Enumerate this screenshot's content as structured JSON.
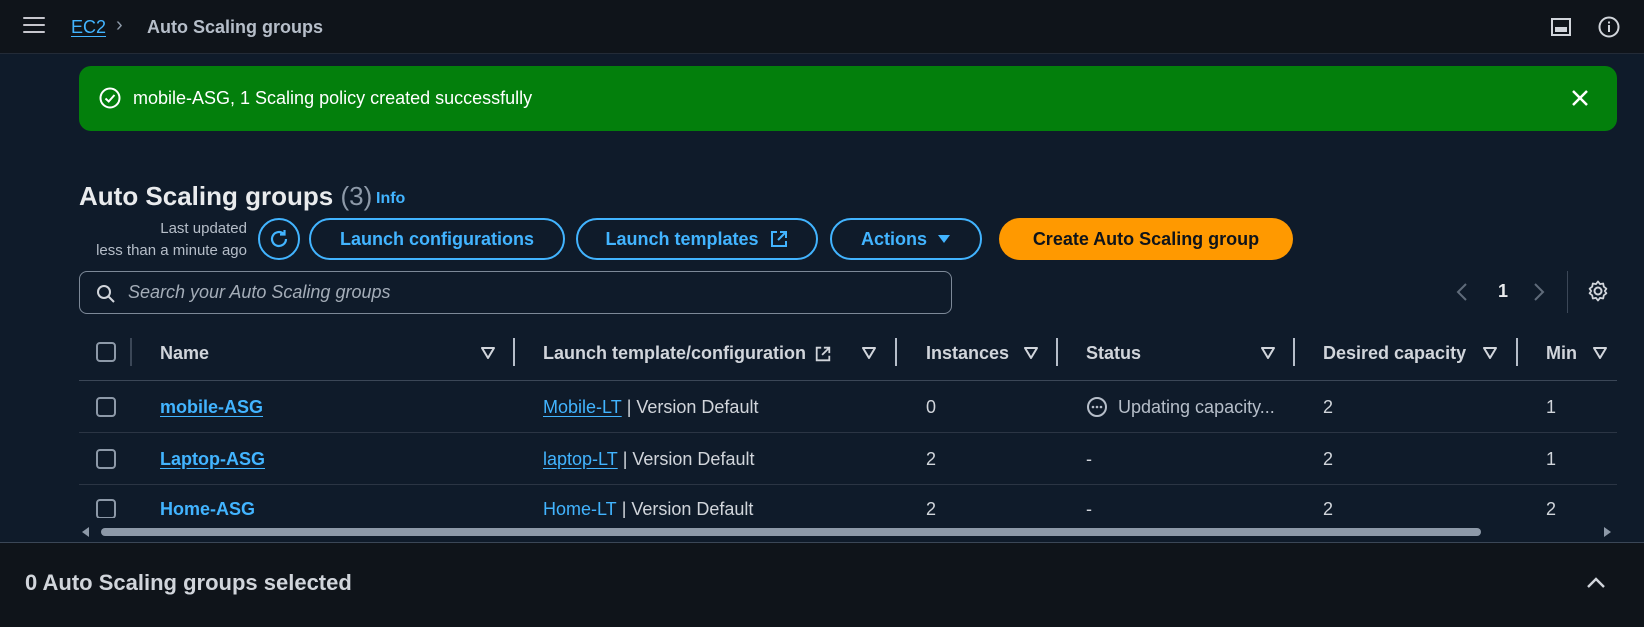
{
  "breadcrumb": {
    "parent": "EC2",
    "current": "Auto Scaling groups"
  },
  "flash": {
    "message": "mobile-ASG, 1 Scaling policy created successfully",
    "color": "#037f0c"
  },
  "header": {
    "title": "Auto Scaling groups",
    "count": "(3)",
    "info_label": "Info",
    "last_updated_line1": "Last updated",
    "last_updated_line2": "less than a minute ago"
  },
  "toolbar": {
    "launch_configurations_label": "Launch configurations",
    "launch_templates_label": "Launch templates",
    "actions_label": "Actions",
    "create_label": "Create Auto Scaling group"
  },
  "search": {
    "placeholder": "Search your Auto Scaling groups",
    "value": ""
  },
  "pagination": {
    "current_page": "1"
  },
  "table": {
    "columns": [
      "Name",
      "Launch template/configuration",
      "Instances",
      "Status",
      "Desired capacity",
      "Min"
    ],
    "rows": [
      {
        "name": "mobile-ASG",
        "template_name": "Mobile-LT",
        "template_version": " | Version Default",
        "instances": "0",
        "status": "Updating capacity...",
        "desired": "2",
        "min": "1"
      },
      {
        "name": "Laptop-ASG",
        "template_name": "laptop-LT",
        "template_version": " | Version Default",
        "instances": "2",
        "status": "-",
        "desired": "2",
        "min": "1"
      },
      {
        "name": "Home-ASG",
        "template_name": "Home-LT",
        "template_version": " | Version Default",
        "instances": "2",
        "status": "-",
        "desired": "2",
        "min": "2"
      }
    ]
  },
  "bottom_panel": {
    "title": "0 Auto Scaling groups selected"
  },
  "colors": {
    "accent": "#42b4ff",
    "primary_button": "#ff9900",
    "success": "#037f0c"
  }
}
